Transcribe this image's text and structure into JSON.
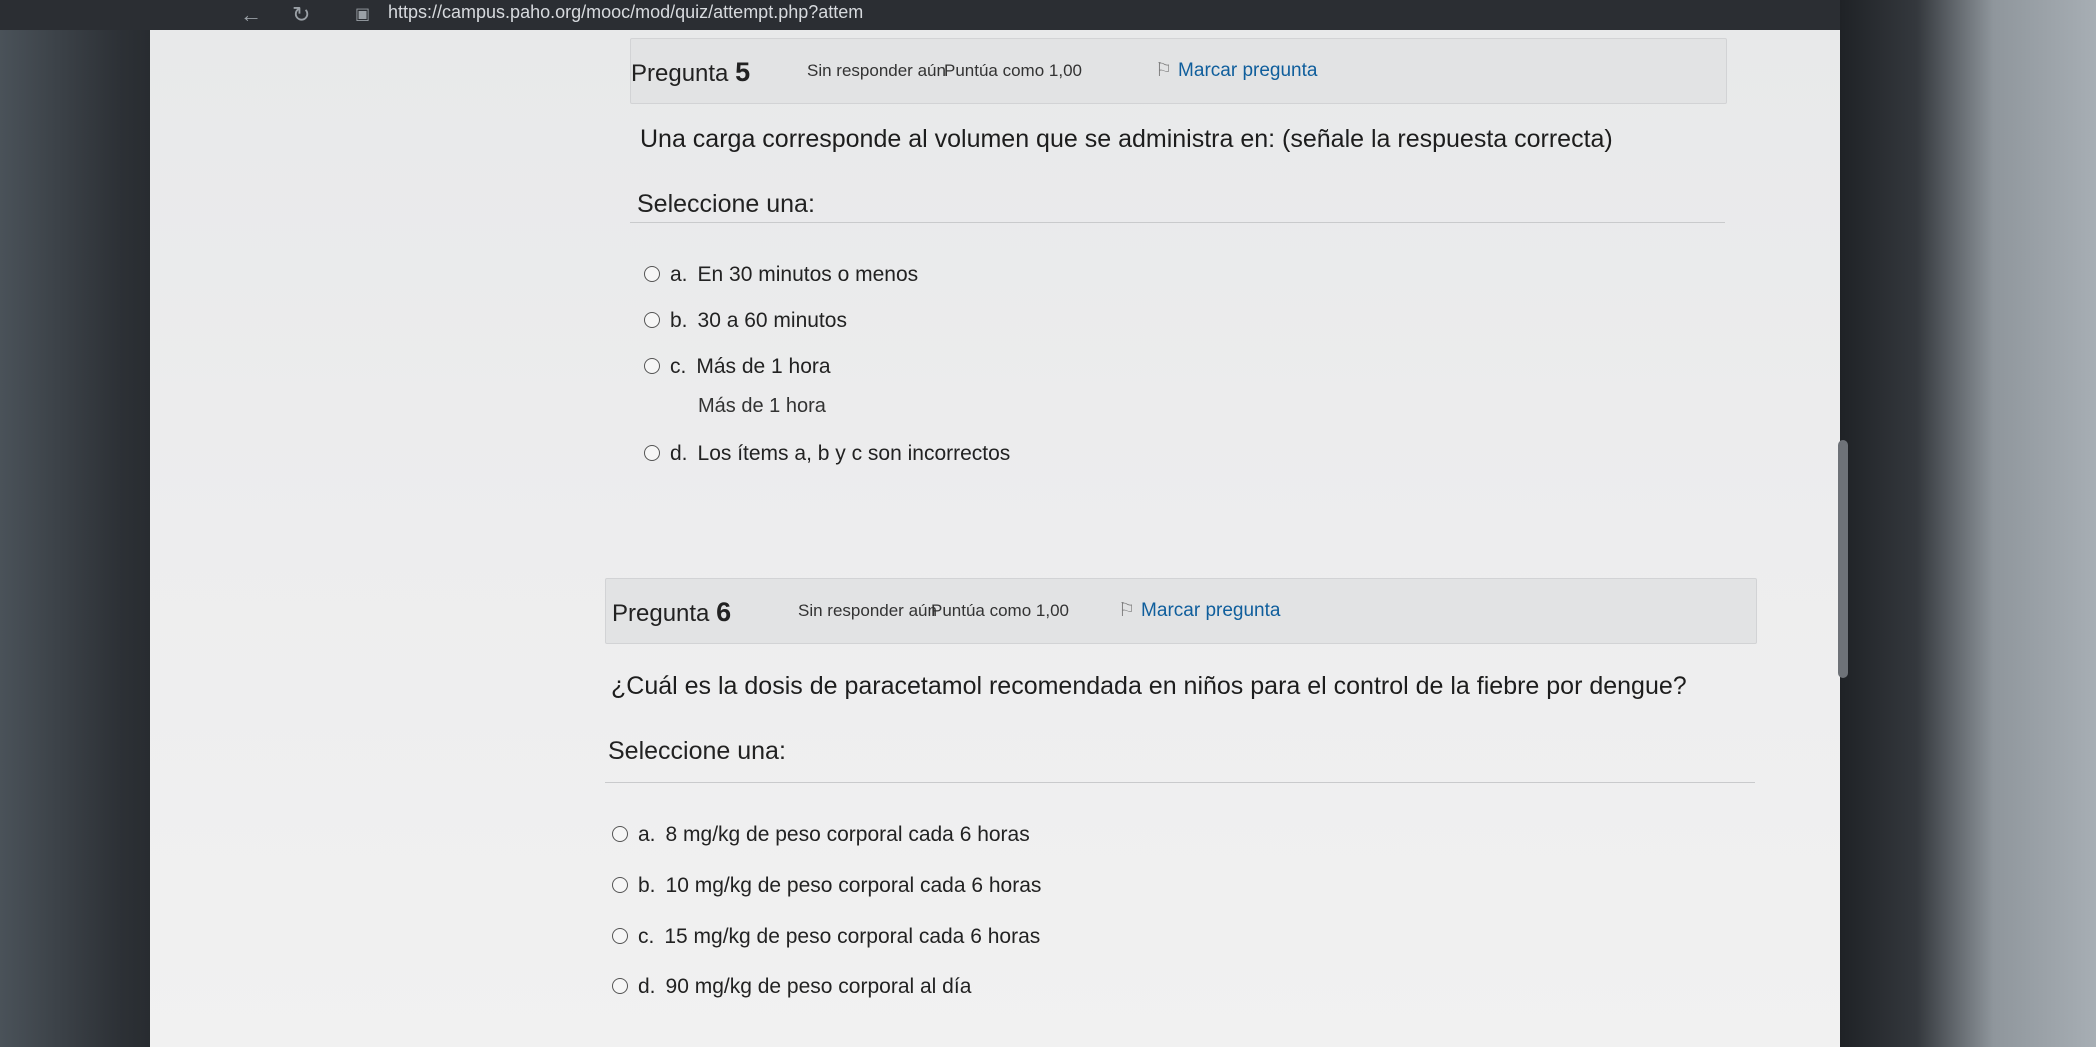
{
  "browser": {
    "url": "https://campus.paho.org/mooc/mod/quiz/attempt.php?attem"
  },
  "questions": [
    {
      "label": "Pregunta",
      "number": "5",
      "state": "Sin responder aún",
      "grade": "Puntúa como 1,00",
      "flag_label": "Marcar pregunta",
      "text": "Una carga corresponde al volumen que se administra en: (señale la respuesta correcta)",
      "prompt": "Seleccione una:",
      "answers": [
        {
          "letter": "a.",
          "text": "En 30 minutos o menos"
        },
        {
          "letter": "b.",
          "text": "30 a 60 minutos"
        },
        {
          "letter": "c.",
          "text": "Más de 1 hora"
        },
        {
          "letter": "d.",
          "text": "Los ítems a, b y c son incorrectos"
        }
      ],
      "extra_text": "Más de 1 hora"
    },
    {
      "label": "Pregunta",
      "number": "6",
      "state": "Sin responder aún",
      "grade": "Puntúa como 1,00",
      "flag_label": "Marcar pregunta",
      "text": "¿Cuál es la dosis de paracetamol recomendada en niños para el control de la fiebre por dengue?",
      "prompt": "Seleccione una:",
      "answers": [
        {
          "letter": "a.",
          "text": "8 mg/kg de peso corporal cada 6 horas"
        },
        {
          "letter": "b.",
          "text": "10 mg/kg de peso corporal cada 6 horas"
        },
        {
          "letter": "c.",
          "text": "15 mg/kg de peso corporal cada 6 horas"
        },
        {
          "letter": "d.",
          "text": "90 mg/kg de peso corporal al día"
        }
      ]
    }
  ]
}
